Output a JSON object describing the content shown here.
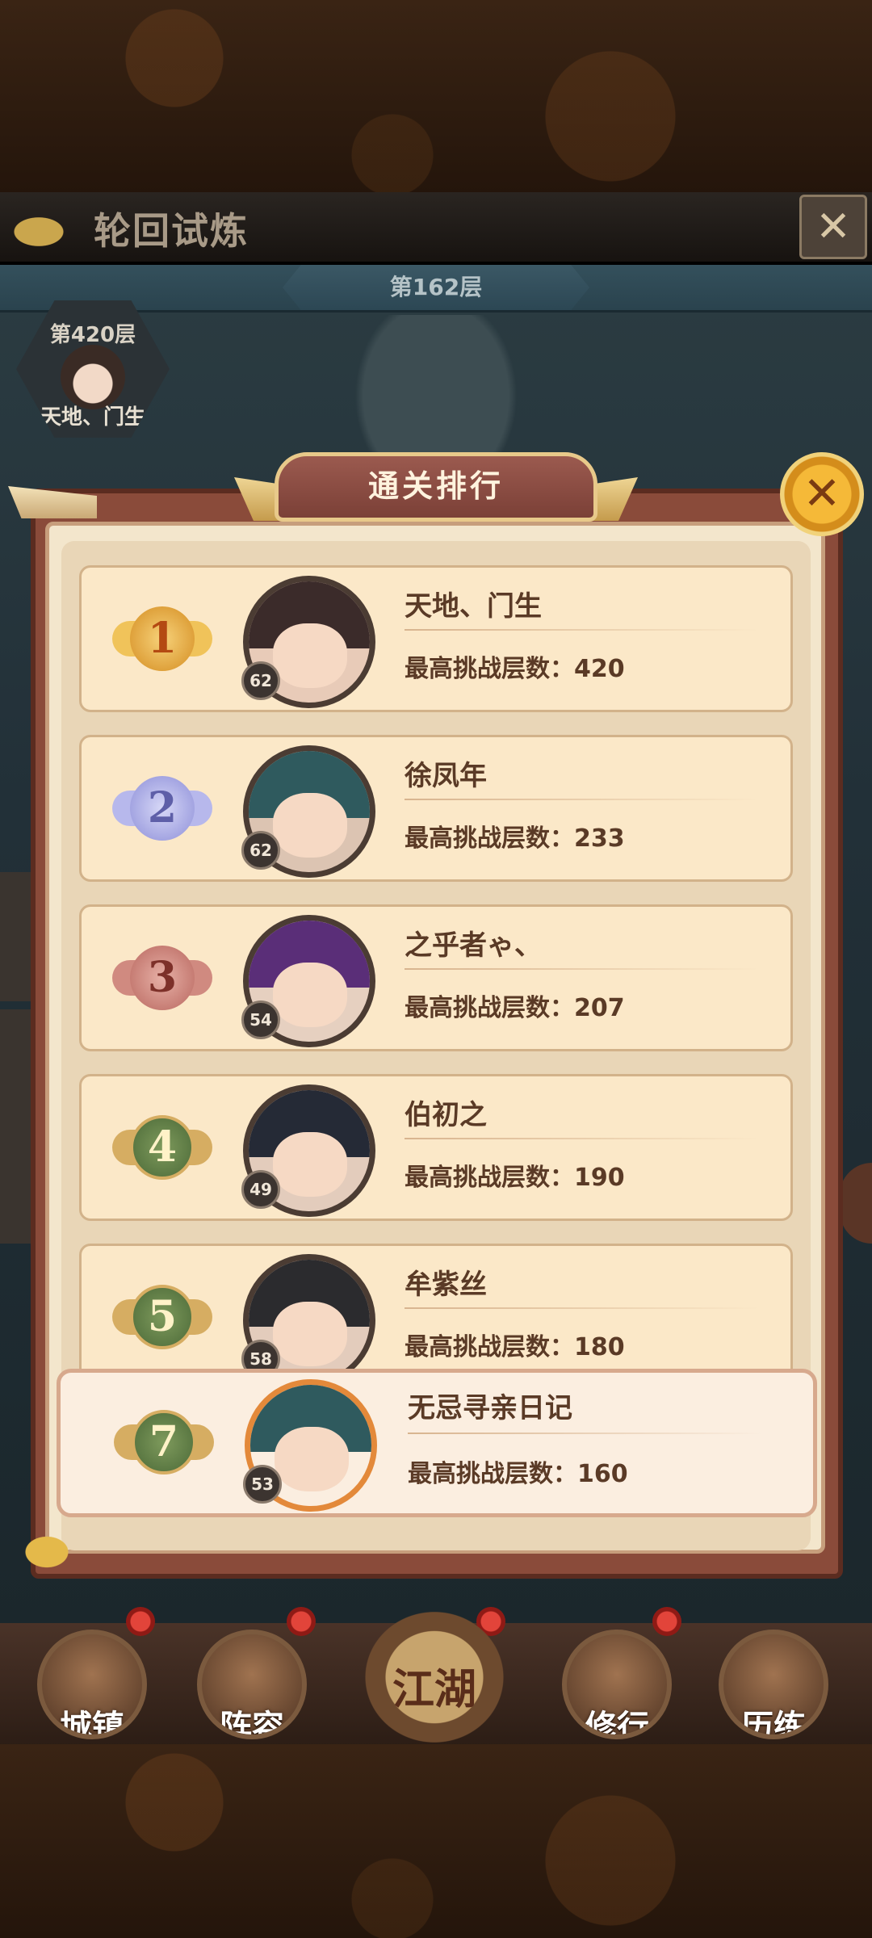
{
  "header": {
    "title": "轮回试炼",
    "floor_label": "第162层"
  },
  "top_player": {
    "floor": "第420层",
    "name": "天地、门生"
  },
  "panel": {
    "title": "通关排行"
  },
  "rankings": [
    {
      "rank": "1",
      "name": "天地、门生",
      "level": "62",
      "score_label": "最高挑战层数：420",
      "medal_color": "#e3a230"
    },
    {
      "rank": "2",
      "name": "徐凤年",
      "level": "62",
      "score_label": "最高挑战层数：233",
      "medal_color": "#8d8ed8"
    },
    {
      "rank": "3",
      "name": "之乎者ゃ、",
      "level": "54",
      "score_label": "最高挑战层数：207",
      "medal_color": "#b8665e"
    },
    {
      "rank": "4",
      "name": "伯初之",
      "level": "49",
      "score_label": "最高挑战层数：190",
      "medal_color": "#5a7a44"
    },
    {
      "rank": "5",
      "name": "牟紫丝",
      "level": "58",
      "score_label": "最高挑战层数：180",
      "medal_color": "#5a7a44"
    }
  ],
  "my_rank": {
    "rank": "7",
    "name": "无忌寻亲日记",
    "level": "53",
    "score_label": "最高挑战层数：160",
    "medal_color": "#5a7a44"
  },
  "bottom_nav": [
    {
      "label": "城镇"
    },
    {
      "label": "阵容"
    },
    {
      "label": "江湖"
    },
    {
      "label": "修行"
    },
    {
      "label": "历练"
    }
  ]
}
